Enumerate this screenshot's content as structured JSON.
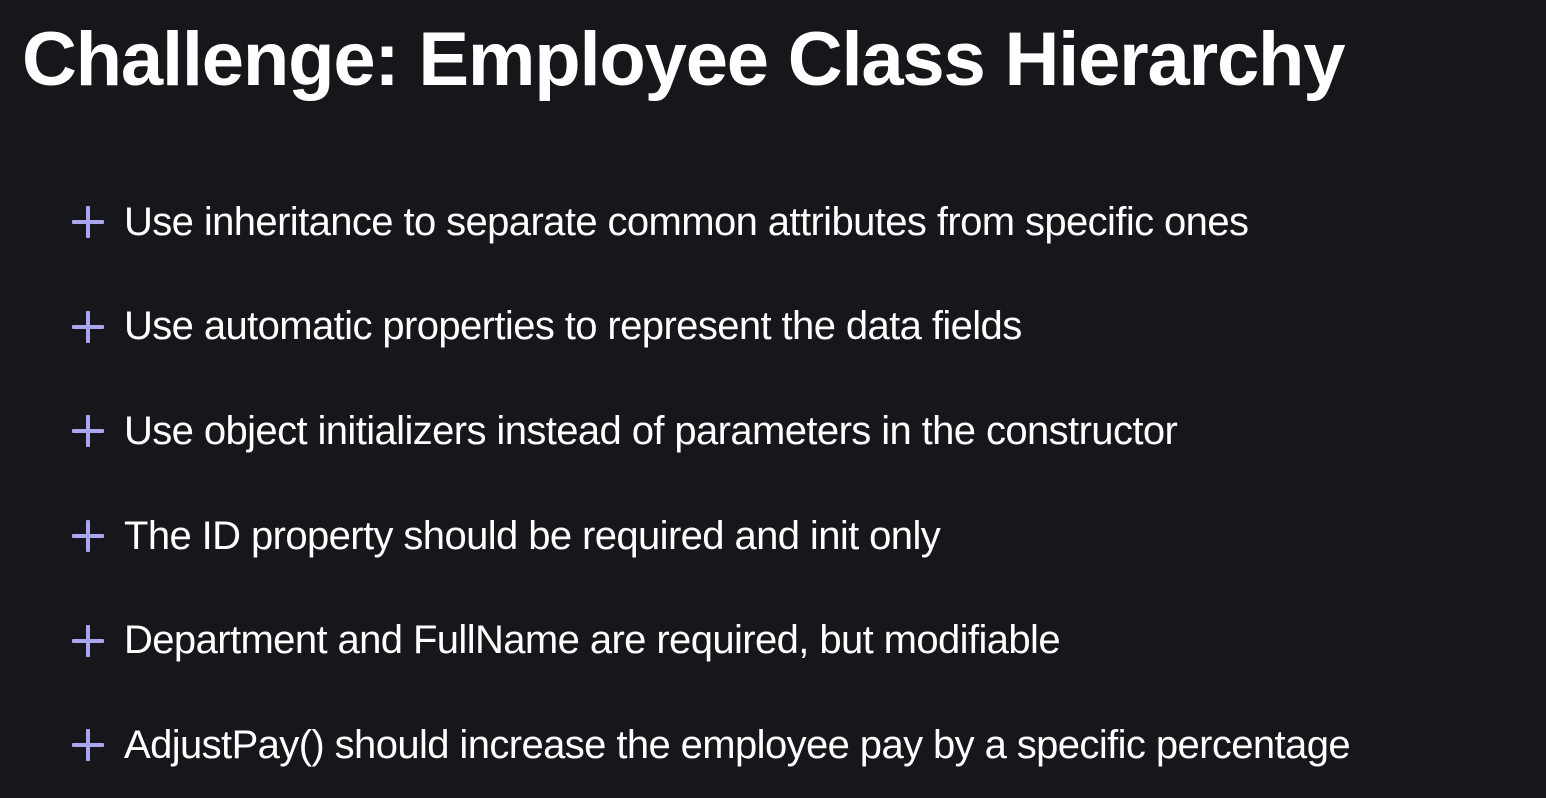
{
  "slide": {
    "title": "Challenge: Employee Class Hierarchy",
    "bullets": [
      "Use inheritance to separate common attributes from specific ones",
      "Use automatic properties to represent the data fields",
      "Use object initializers instead of parameters in the constructor",
      "The ID property should be required and init only",
      "Department and FullName are required, but modifiable",
      "AdjustPay() should increase the employee pay by a specific percentage"
    ],
    "colors": {
      "background": "#16161b",
      "text": "#ffffff",
      "bullet_accent": "#a8a6ee"
    },
    "bullet_icon": "plus-icon"
  }
}
